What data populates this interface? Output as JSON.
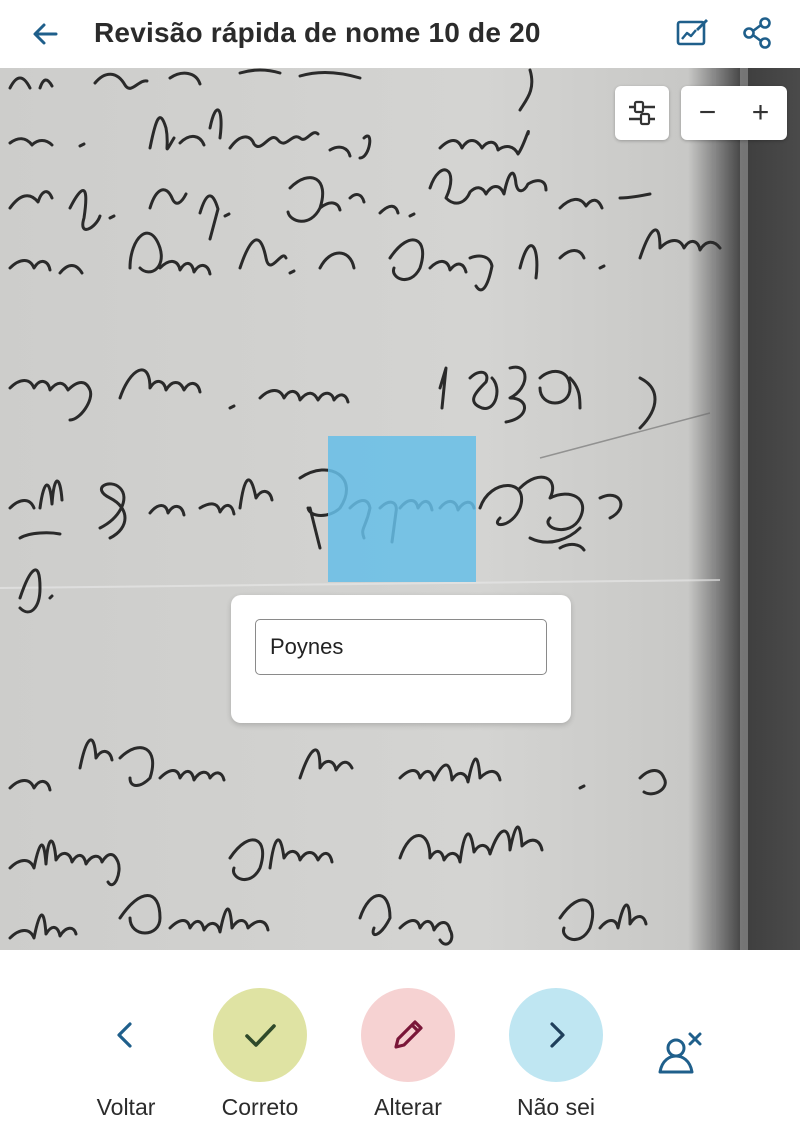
{
  "header": {
    "title": "Revisão rápida de nome 10 de 20",
    "back_icon": "arrow-left-icon",
    "image_icon": "image-edit-icon",
    "share_icon": "share-icon"
  },
  "viewer": {
    "zoom_out_label": "−",
    "zoom_in_label": "+",
    "adjust_icon": "sliders-icon"
  },
  "card": {
    "name_value": "Poynes"
  },
  "actions": [
    {
      "label": "Voltar",
      "icon": "chevron-left-icon"
    },
    {
      "label": "Correto",
      "icon": "check-icon",
      "color": "#dfe3a3"
    },
    {
      "label": "Alterar",
      "icon": "pencil-icon",
      "color": "#f6d2d2"
    },
    {
      "label": "Não sei",
      "icon": "chevron-right-icon",
      "color": "#bfe6f2"
    }
  ],
  "skip_icon": "person-remove-icon",
  "colors": {
    "accent": "#1f5f8b",
    "highlight": "#66bee8",
    "pencil": "#7a1638"
  }
}
